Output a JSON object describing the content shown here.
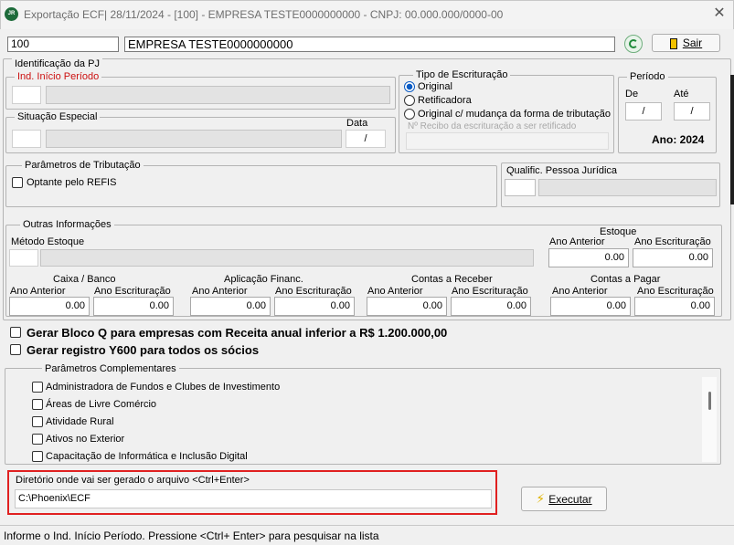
{
  "window": {
    "title": "Exportação ECF| 28/11/2024 - [100] - EMPRESA TESTE0000000000 - CNPJ: 00.000.000/0000-00",
    "app_icon": "JR",
    "close_symbol": "✕"
  },
  "header": {
    "code": "100",
    "company": "EMPRESA TESTE0000000000",
    "sair_label": "Sair"
  },
  "identificacao": {
    "legend": "Identificação da PJ",
    "ind_inicio_label": "Ind. Início Período"
  },
  "situacao": {
    "legend": "Situação Especial",
    "data_label": "Data",
    "data_value": "/"
  },
  "tipo_escrituracao": {
    "legend": "Tipo de Escrituração",
    "options": [
      "Original",
      "Retificadora",
      "Original c/ mudança da forma de tributação"
    ],
    "selected": "Original",
    "recibo_placeholder": "Nº Recibo da escrituração a ser retificado"
  },
  "periodo": {
    "legend": "Período",
    "de_label": "De",
    "ate_label": "Até",
    "de_value": "/",
    "ate_value": "/",
    "ano_text": "Ano: 2024"
  },
  "parametros_tributacao": {
    "legend": "Parâmetros de Tributação",
    "refis_label": "Optante pelo REFIS"
  },
  "qualific": {
    "label": "Qualific. Pessoa Jurídica"
  },
  "outras": {
    "legend": "Outras Informações",
    "metodo_label": "Método Estoque",
    "estoque_title": "Estoque",
    "estoque_ano_anterior_label": "Ano Anterior",
    "estoque_ano_escrit_label": "Ano Escrituração",
    "estoque_ano_anterior": "0.00",
    "estoque_ano_escrit": "0.00",
    "groups": [
      {
        "title": "Caixa / Banco",
        "left_label": "Ano  Anterior",
        "right_label": "Ano Escrituração",
        "left_value": "0.00",
        "right_value": "0.00"
      },
      {
        "title": "Aplicação Financ.",
        "left_label": "Ano  Anterior",
        "right_label": "Ano Escrituração",
        "left_value": "0.00",
        "right_value": "0.00"
      },
      {
        "title": "Contas a Receber",
        "left_label": "Ano Anterior",
        "right_label": "Ano Escrituração",
        "left_value": "0.00",
        "right_value": "0.00"
      },
      {
        "title": "Contas a Pagar",
        "left_label": "Ano Anterior",
        "right_label": "Ano Escrituração",
        "left_value": "0.00",
        "right_value": "0.00"
      }
    ]
  },
  "options": {
    "bloco_q": "Gerar Bloco Q para empresas com Receita anual inferior a R$ 1.200.000,00",
    "y600": "Gerar registro Y600 para todos os sócios"
  },
  "complementares": {
    "legend": "Parâmetros Complementares",
    "items": [
      "Administradora de Fundos e Clubes de Investimento",
      "Áreas de Livre Comércio",
      "Atividade Rural",
      "Ativos no Exterior",
      "Capacitação de Informática e Inclusão Digital"
    ]
  },
  "diretorio": {
    "label": "Diretório onde vai ser gerado o arquivo <Ctrl+Enter>",
    "value": "C:\\Phoenix\\ECF",
    "highlight_color": "#e02020"
  },
  "executar_label": "Executar",
  "status_bar": "Informe o Ind. Início Período. Pressione <Ctrl+ Enter> para pesquisar na lista",
  "colors": {
    "ind_label_red": "#cc1010",
    "radio_blue": "#0a5bc4"
  }
}
